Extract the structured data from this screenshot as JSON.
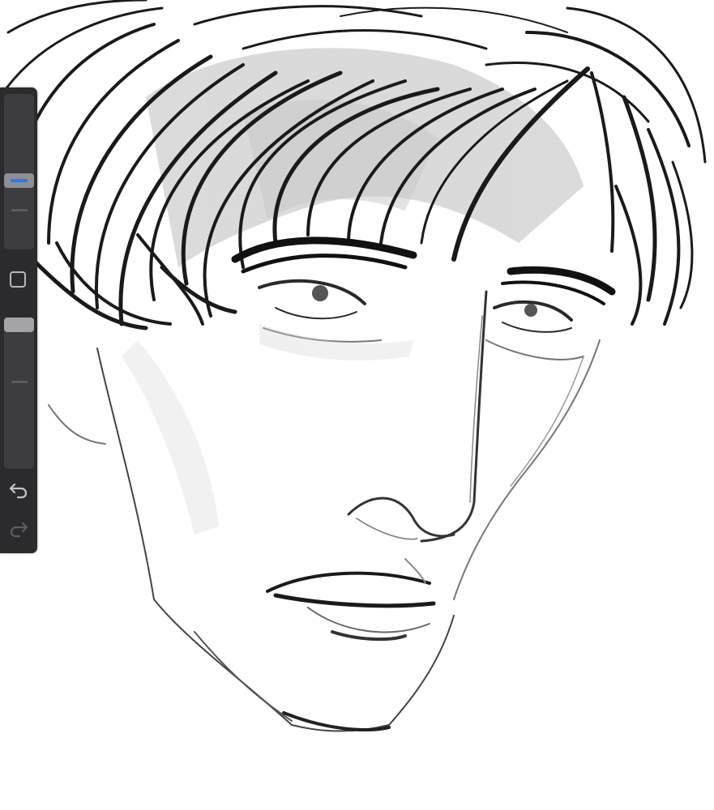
{
  "app": {
    "type": "drawing-canvas"
  },
  "toolbar": {
    "brush_size": {
      "icon": "brush-size-slider",
      "value_fraction": 0.55
    },
    "modify_icon": "square-icon",
    "opacity": {
      "icon": "opacity-slider",
      "value_fraction": 1.0
    },
    "undo_icon": "undo-icon",
    "redo_icon": "redo-icon",
    "accent_color": "#1f7cff"
  },
  "canvas": {
    "background": "#ffffff",
    "stroke_color": "#1a1a1a"
  }
}
